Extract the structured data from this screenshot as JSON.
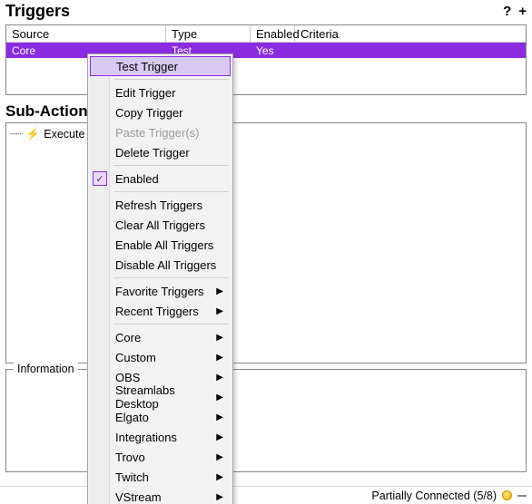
{
  "panel": {
    "title": "Triggers",
    "help_icon": "?",
    "add_icon": "+"
  },
  "columns": {
    "source": "Source",
    "type": "Type",
    "enabled": "Enabled",
    "criteria": "Criteria"
  },
  "rows": [
    {
      "source": "Core",
      "type": "Test",
      "enabled": "Yes",
      "criteria": ""
    }
  ],
  "sub_panel": {
    "title": "Sub-Actions"
  },
  "subactions": [
    {
      "label": "Execute"
    }
  ],
  "subaction_suffix": ")",
  "info": {
    "label": "Information"
  },
  "status": {
    "text": "Partially Connected (5/8)"
  },
  "context_menu": {
    "check_mark": "✓",
    "items": [
      {
        "label": "Test Trigger",
        "highlight": true
      },
      {
        "sep": true
      },
      {
        "label": "Edit Trigger"
      },
      {
        "label": "Copy Trigger"
      },
      {
        "label": "Paste Trigger(s)",
        "disabled": true
      },
      {
        "label": "Delete Trigger"
      },
      {
        "sep": true
      },
      {
        "label": "Enabled",
        "checked": true
      },
      {
        "sep": true
      },
      {
        "label": "Refresh Triggers"
      },
      {
        "label": "Clear All Triggers"
      },
      {
        "label": "Enable All Triggers"
      },
      {
        "label": "Disable All Triggers"
      },
      {
        "sep": true
      },
      {
        "label": "Favorite Triggers",
        "submenu": true
      },
      {
        "label": "Recent Triggers",
        "submenu": true
      },
      {
        "sep": true
      },
      {
        "label": "Core",
        "submenu": true
      },
      {
        "label": "Custom",
        "submenu": true
      },
      {
        "label": "OBS",
        "submenu": true
      },
      {
        "label": "Streamlabs Desktop",
        "submenu": true
      },
      {
        "label": "Elgato",
        "submenu": true
      },
      {
        "label": "Integrations",
        "submenu": true
      },
      {
        "label": "Trovo",
        "submenu": true
      },
      {
        "label": "Twitch",
        "submenu": true
      },
      {
        "label": "VStream",
        "submenu": true
      }
    ]
  }
}
